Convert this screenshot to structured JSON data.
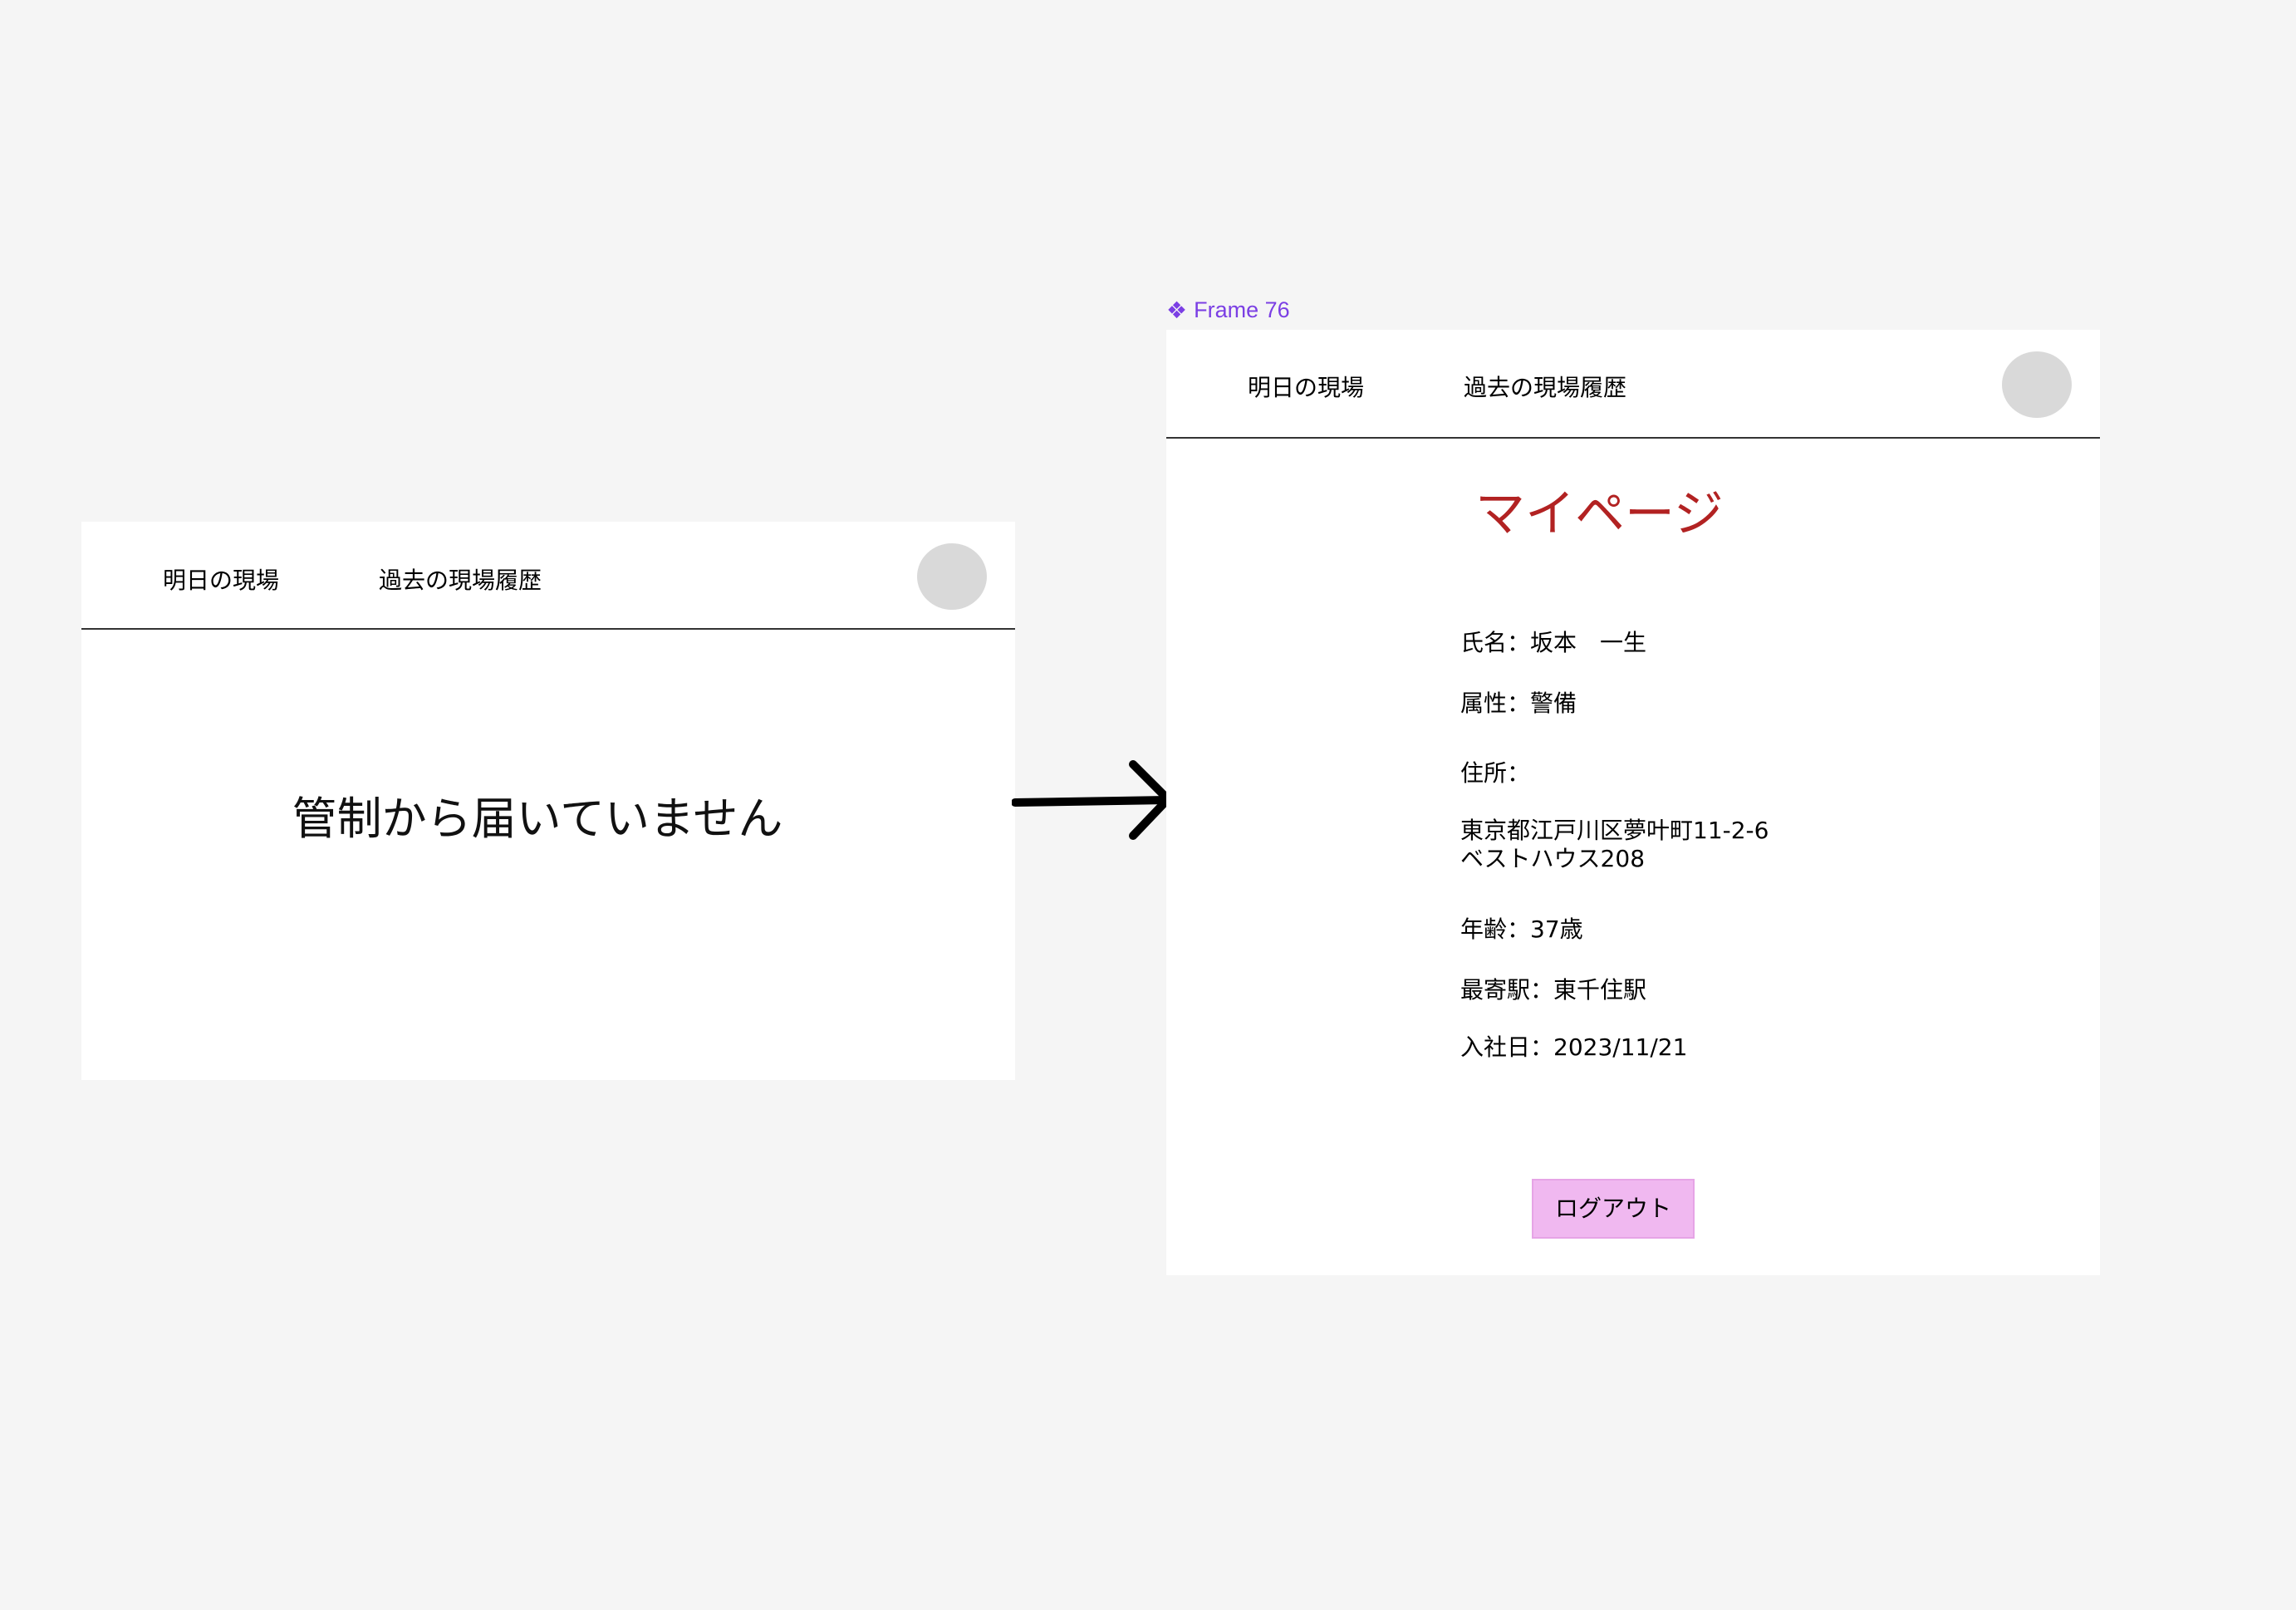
{
  "frame_label": "Frame 76",
  "left_screen": {
    "nav": {
      "tomorrow": "明日の現場",
      "history": "過去の現場履歴"
    },
    "empty_message": "管制から届いていません"
  },
  "right_screen": {
    "nav": {
      "tomorrow": "明日の現場",
      "history": "過去の現場履歴"
    },
    "title": "マイページ",
    "profile": {
      "name": "氏名：坂本　一生",
      "attribute": "属性：警備",
      "address_label": "住所：",
      "address_line1": "東京都江戸川区夢叶町11-2-6",
      "address_line2": "ベストハウス208",
      "age": "年齢：37歳",
      "nearest_station": "最寄駅：東千住駅",
      "join_date": "入社日：2023/11/21"
    },
    "logout_label": "ログアウト"
  },
  "colors": {
    "canvas": "#f5f5f5",
    "frame": "#ffffff",
    "title": "#b22222",
    "logout_bg": "#f0b8f0",
    "avatar": "#d9d9d9",
    "frame_label": "#7b3fe4"
  },
  "icons": {
    "frame_label_icon": "component-icon",
    "flow": "arrow-right-icon"
  }
}
